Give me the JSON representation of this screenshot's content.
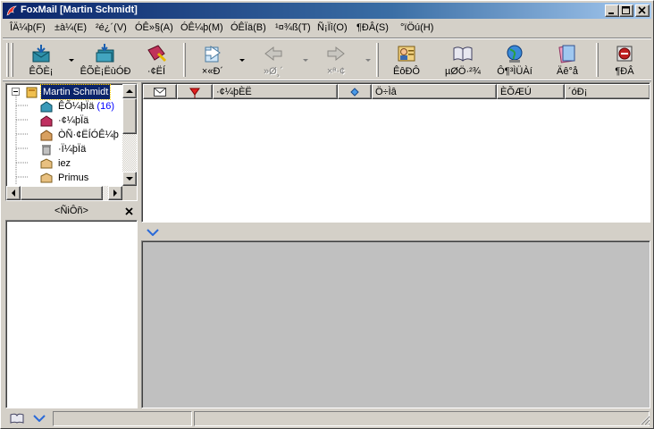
{
  "window": {
    "title": "FoxMail [Martin Schmidt]",
    "accent_color": "#0a246a"
  },
  "menu": [
    {
      "label": "ÎÄ¼þ(F)"
    },
    {
      "label": "±à¼­(E)"
    },
    {
      "label": "²é¿´(V)"
    },
    {
      "label": "ÓÊ»§(A)"
    },
    {
      "label": "ÓÊ¼þ(M)"
    },
    {
      "label": "ÓÊÏä(B)"
    },
    {
      "label": "¹¤¾ß(T)"
    },
    {
      "label": "Ñ¡Ïî(O)"
    },
    {
      "label": "¶ÐÂ(S)"
    },
    {
      "label": "°ïÖú(H)"
    }
  ],
  "toolbar": {
    "receive": {
      "label": "ÊÕÈ¡",
      "icon": "receive-mail-icon"
    },
    "receive_all": {
      "label": "ÊÕÈ¡ËùÓÐ",
      "icon": "receive-all-icon"
    },
    "compose": {
      "label": "·¢ËÍ",
      "icon": "compose-mail-icon"
    },
    "reply": {
      "label": "×«Ð´",
      "icon": "reply-icon"
    },
    "reply_all": {
      "label": "»Ø¸´",
      "icon": "reply-all-icon"
    },
    "forward": {
      "label": "×ª·¢",
      "icon": "forward-icon"
    },
    "address_book": {
      "label": "ÊôÐÔ",
      "icon": "address-book-icon"
    },
    "book": {
      "label": "µØÖ·²¾",
      "icon": "book-icon"
    },
    "globe": {
      "label": "Ô¶³ÌÜÀí",
      "icon": "globe-icon"
    },
    "notes": {
      "label": "Äê°å",
      "icon": "notes-icon"
    },
    "anti_spam": {
      "label": "¶ÐÂ",
      "icon": "anti-spam-icon"
    }
  },
  "folders": [
    {
      "name": "Martin Schmidt",
      "icon": "account-icon",
      "selected": true
    },
    {
      "name": "ÊÕ¼þÏä",
      "count": "(16)",
      "icon": "inbox-icon"
    },
    {
      "name": "·¢¼þÏä",
      "icon": "outbox-icon"
    },
    {
      "name": "ÒÑ·¢ËÍÓÊ¼þ",
      "icon": "sent-icon"
    },
    {
      "name": "·Ï¼þÏä",
      "icon": "trash-icon"
    },
    {
      "name": "iez",
      "icon": "folder-icon"
    },
    {
      "name": "Primus",
      "icon": "folder-icon"
    }
  ],
  "contacts": {
    "header": "<ÑiÔñ>"
  },
  "columns": [
    {
      "label": "",
      "icon": "envelope-icon"
    },
    {
      "label": "",
      "icon": "flag-icon"
    },
    {
      "label": "·¢¼þÈË"
    },
    {
      "label": "",
      "icon": "priority-icon"
    },
    {
      "label": "Ö÷Ìâ"
    },
    {
      "label": "ÈÕÆÚ"
    },
    {
      "label": "´óÐ¡"
    }
  ],
  "status": {
    "cells": [
      "",
      ""
    ]
  }
}
